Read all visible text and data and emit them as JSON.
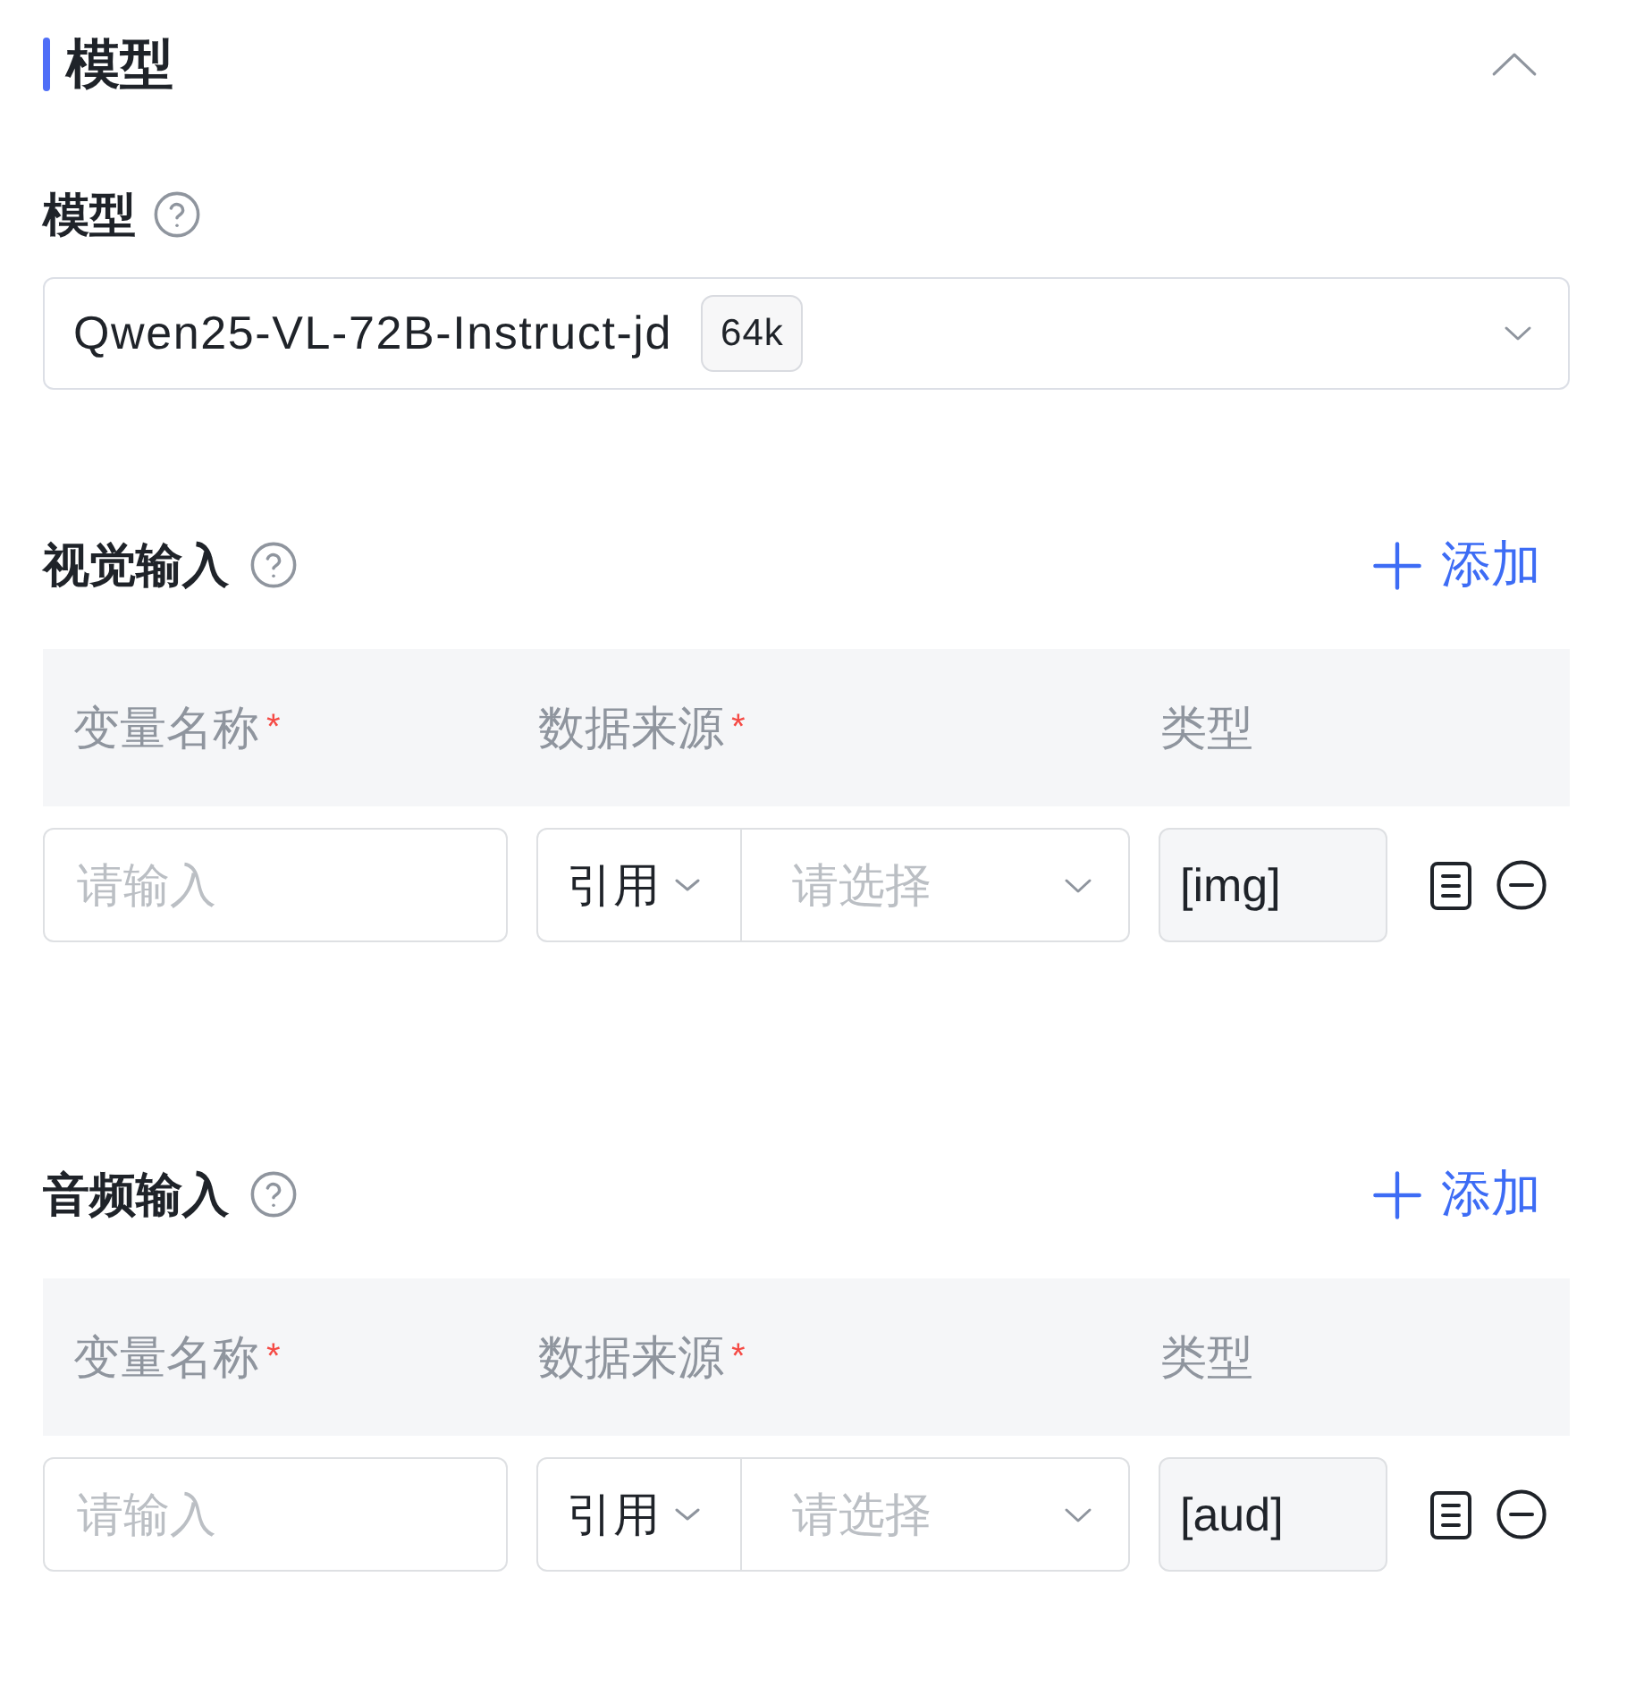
{
  "section": {
    "title": "模型",
    "expanded": true
  },
  "model": {
    "label": "模型",
    "value": "Qwen25-VL-72B-Instruct-jd",
    "tag": "64k"
  },
  "input_groups": [
    {
      "label": "视觉输入",
      "add_button": "添加",
      "columns": [
        {
          "label": "变量名称",
          "required_mark": "*"
        },
        {
          "label": "数据来源",
          "required_mark": "*"
        },
        {
          "label": "类型"
        }
      ],
      "rows": [
        {
          "name_placeholder": "请输入",
          "source_mode": "引用",
          "source_placeholder": "请选择",
          "type": {
            "value": "[img]",
            "disabled": true
          }
        }
      ]
    },
    {
      "label": "音频输入",
      "add_button": "添加",
      "columns": [
        {
          "label": "变量名称",
          "required_mark": "*"
        },
        {
          "label": "数据来源",
          "required_mark": "*"
        },
        {
          "label": "类型"
        }
      ],
      "rows": [
        {
          "name_placeholder": "请输入",
          "source_mode": "引用",
          "source_placeholder": "请选择",
          "type": {
            "value": "[aud]",
            "disabled": true
          }
        }
      ]
    }
  ]
}
